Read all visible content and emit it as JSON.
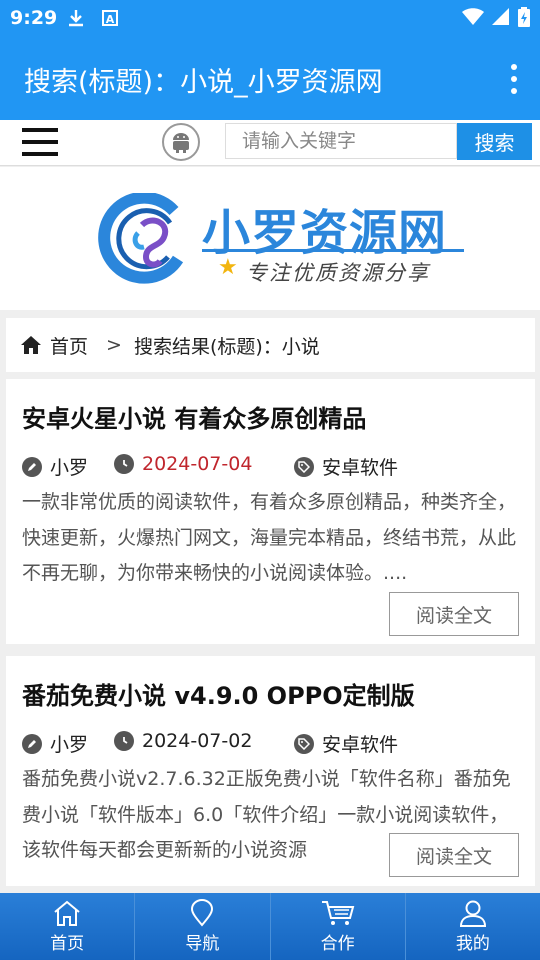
{
  "status": {
    "time": "9:29"
  },
  "appbar": {
    "title": "搜索(标题)：小说_小罗资源网"
  },
  "search": {
    "placeholder": "请输入关键字",
    "button": "搜索"
  },
  "logo": {
    "title": "小罗资源网",
    "slogan": "专注优质资源分享"
  },
  "breadcrumb": {
    "home": "首页",
    "separator": ">",
    "current": "搜索结果(标题)：小说"
  },
  "posts": [
    {
      "title": "安卓火星小说 有着众多原创精品",
      "author": "小罗",
      "date": "2024-07-04",
      "category": "安卓软件",
      "excerpt": "一款非常优质的阅读软件，有着众多原创精品，种类齐全，快速更新，火爆热门网文，海量完本精品，终结书荒，从此不再无聊，为你带来畅快的小说阅读体验。....",
      "read_more": "阅读全文"
    },
    {
      "title": "番茄免费小说 v4.9.0 OPPO定制版",
      "author": "小罗",
      "date": "2024-07-02",
      "category": "安卓软件",
      "excerpt": "番茄免费小说v2.7.6.32正版免费小说「软件名称」番茄免费小说「软件版本」6.0「软件介绍」一款小说阅读软件，该软件每天都会更新新的小说资源",
      "read_more": "阅读全文"
    }
  ],
  "bottom_nav": [
    {
      "label": "首页",
      "icon": "home-icon"
    },
    {
      "label": "导航",
      "icon": "location-pin-icon"
    },
    {
      "label": "合作",
      "icon": "cart-icon"
    },
    {
      "label": "我的",
      "icon": "user-icon"
    }
  ],
  "colors": {
    "primary": "#2196f3",
    "accent_red": "#c0262d",
    "nav_blue": "#1565c0"
  }
}
